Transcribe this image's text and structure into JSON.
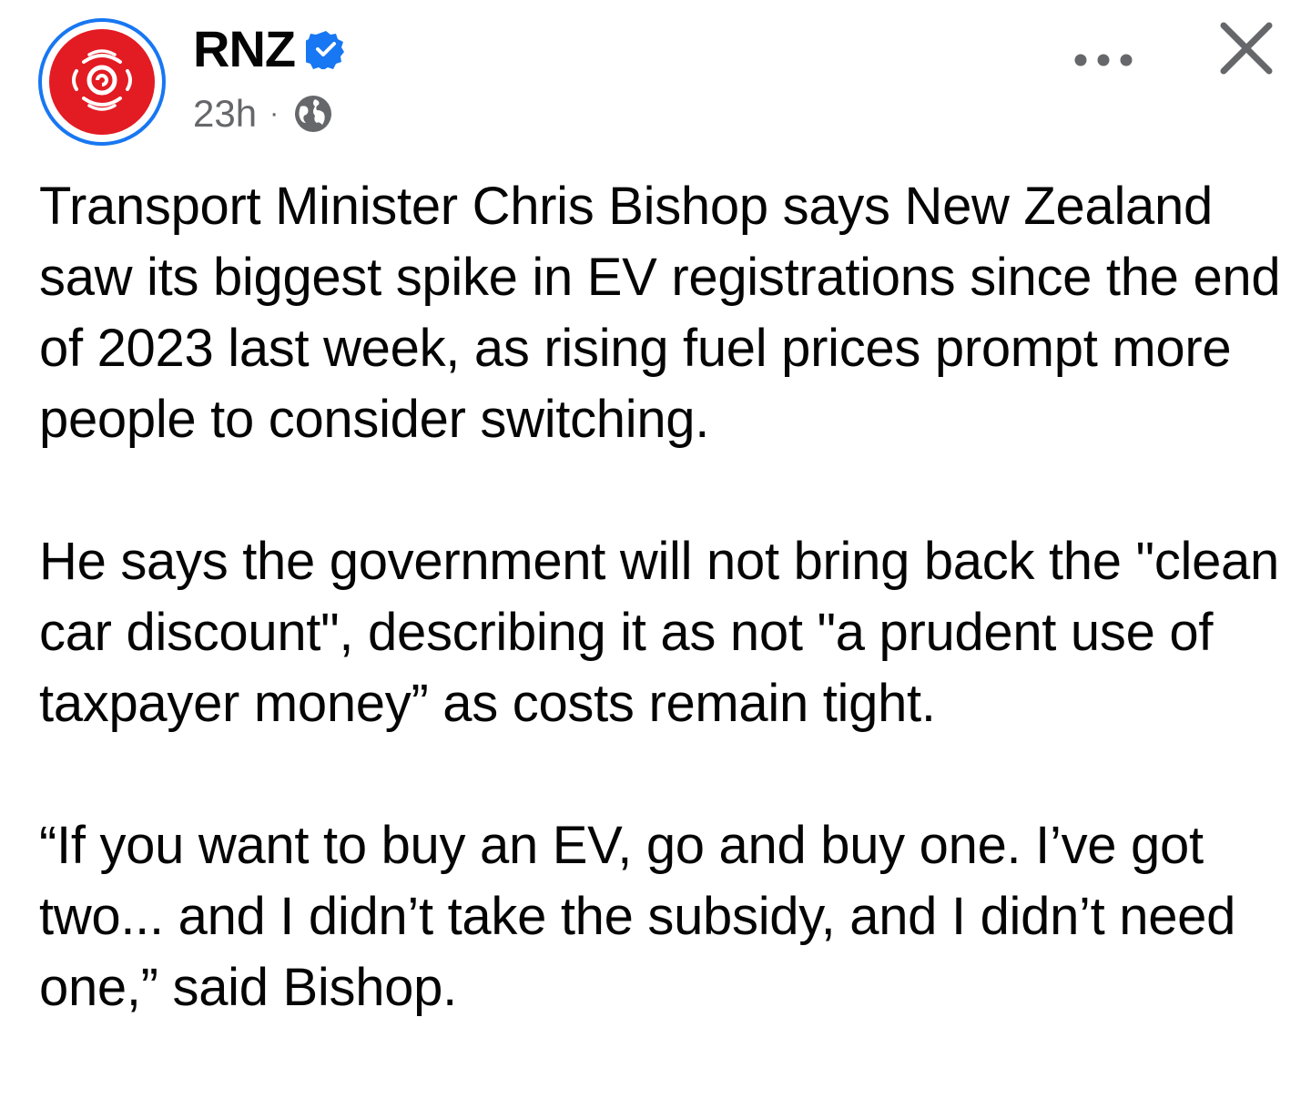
{
  "post": {
    "author": {
      "name": "RNZ",
      "verified": true,
      "avatar_icon": "rnz-logo-icon",
      "brand_color": "#e31b23",
      "ring_color": "#1877f2"
    },
    "meta": {
      "time": "23h",
      "separator": "·",
      "audience_icon": "globe-icon"
    },
    "actions": {
      "more_icon": "more-options-icon",
      "close_icon": "close-icon"
    },
    "paragraphs": [
      "Transport Minister Chris Bishop says New Zealand saw its biggest spike in EV registrations since the end of 2023 last week, as rising fuel prices prompt more people to consider switching.",
      "He says the government will not bring back the \"clean car discount\", describing it as not \"a prudent use of taxpayer money” as costs remain tight.",
      "“If you want to buy an EV, go and buy one. I’ve got two... and I didn’t take the subsidy, and I didn’t need one,” said Bishop."
    ]
  }
}
